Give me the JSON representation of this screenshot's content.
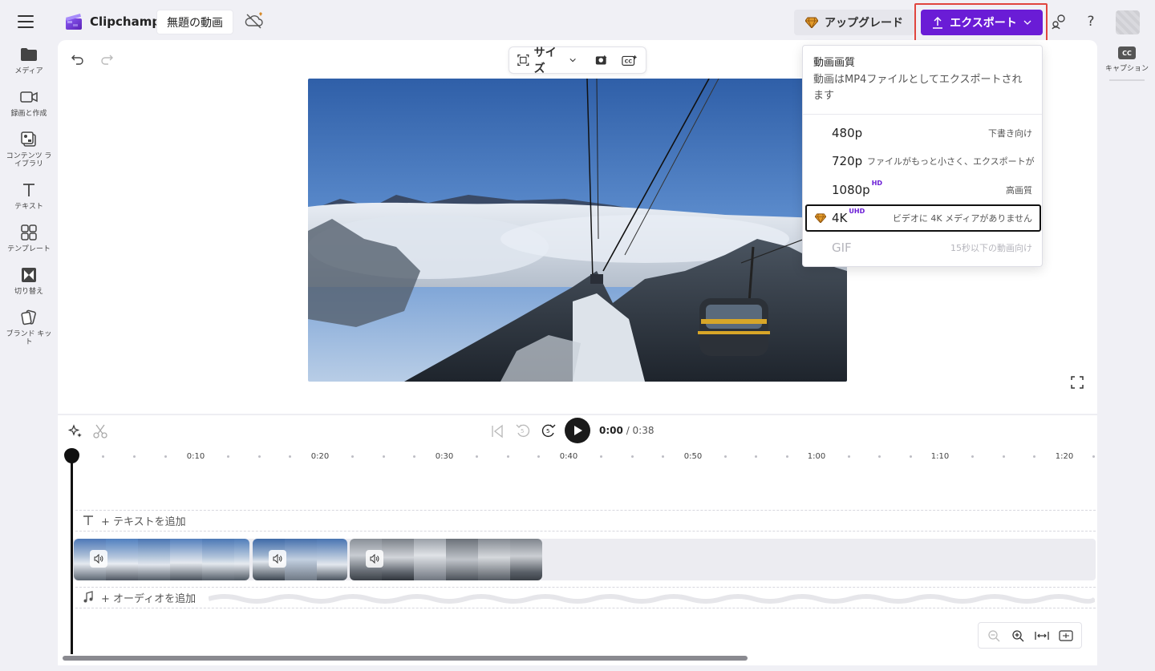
{
  "app": {
    "name": "Clipchamp"
  },
  "header": {
    "project_title": "無題の動画",
    "upgrade_label": "アップグレード",
    "export_label": "エクスポート"
  },
  "sidebar": {
    "items": [
      {
        "label": "メディア",
        "icon": "folder-icon"
      },
      {
        "label": "録画と作成",
        "icon": "video-camera-icon"
      },
      {
        "label": "コンテンツ ライブラリ",
        "icon": "content-library-icon"
      },
      {
        "label": "テキスト",
        "icon": "text-icon"
      },
      {
        "label": "テンプレート",
        "icon": "template-icon"
      },
      {
        "label": "切り替え",
        "icon": "transition-icon"
      },
      {
        "label": "ブランド キット",
        "icon": "brand-kit-icon"
      }
    ]
  },
  "right_panel": {
    "caption_badge": "CC",
    "caption_label": "キャプション"
  },
  "preview": {
    "size_label": "サイズ"
  },
  "export_menu": {
    "title": "動画画質",
    "description": "動画はMP4ファイルとしてエクスポートされます",
    "options": [
      {
        "res": "480p",
        "tag": "",
        "note": "下書き向け",
        "state": "normal"
      },
      {
        "res": "720p",
        "tag": "",
        "note": "ファイルがもっと小さく、エクスポートが",
        "state": "normal"
      },
      {
        "res": "1080p",
        "tag": "HD",
        "note": "高画質",
        "state": "normal"
      },
      {
        "res": "4K",
        "tag": "UHD",
        "note": "ビデオに 4K メディアがありません",
        "state": "selected"
      },
      {
        "res": "GIF",
        "tag": "",
        "note": "15秒以下の動画向け",
        "state": "disabled"
      }
    ]
  },
  "timeline": {
    "current_time": "0:00",
    "total_time": "/ 0:38",
    "ruler": [
      "0:10",
      "0:20",
      "0:30",
      "0:40",
      "0:50",
      "1:00",
      "1:10",
      "1:20"
    ],
    "add_text": "+ テキストを追加",
    "add_audio": "+ オーディオを追加",
    "skip_amount": "5"
  },
  "colors": {
    "accent": "#6a1cd6",
    "highlight_frame": "#e0453e",
    "premium": "#c77b1a"
  }
}
